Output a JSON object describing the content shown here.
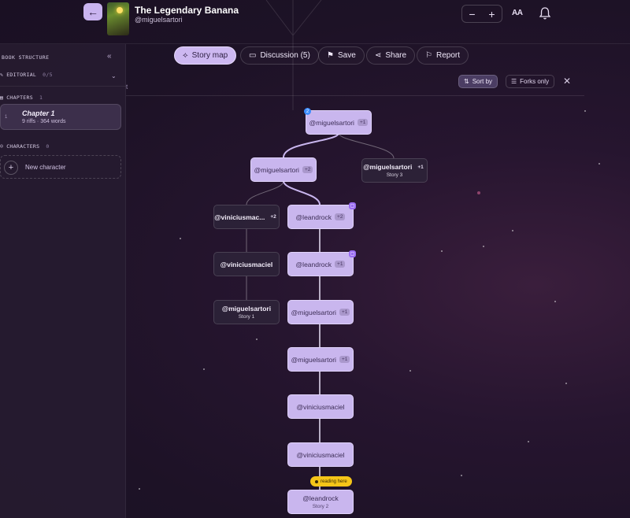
{
  "header": {
    "title": "The Legendary Banana",
    "author": "@miguelsartori",
    "zoom_out": "−",
    "zoom_in": "+",
    "font_toggle": "AA"
  },
  "sidebar": {
    "heading": "BOOK STRUCTURE",
    "editorial": {
      "label": "EDITORIAL",
      "count": "0/5"
    },
    "chapters": {
      "label": "CHAPTERS",
      "count": "1"
    },
    "chapter_items": [
      {
        "num": "1",
        "name": "Chapter 1",
        "meta": "9 riffs · 364 words"
      }
    ],
    "characters": {
      "label": "CHARACTERS",
      "count": "0"
    },
    "new_character": "New character"
  },
  "toolbar": {
    "story_map": "Story map",
    "discussion": "Discussion (5)",
    "save": "Save",
    "share": "Share",
    "report": "Report",
    "sort_by": "Sort by",
    "forks_only": "Forks only",
    "stray": "t"
  },
  "map": {
    "nodes": [
      {
        "user": "@miguelsartori",
        "badge": "+1"
      },
      {
        "user": "@miguelsartori",
        "badge": "+2"
      },
      {
        "user": "@miguelsartori",
        "badge": "+1",
        "sub": "Story 3"
      },
      {
        "user": "@viniciusmac...",
        "badge": "+2"
      },
      {
        "user": "@leandrock",
        "badge": "+2"
      },
      {
        "user": "@viniciusmaciel"
      },
      {
        "user": "@leandrock",
        "badge": "+1"
      },
      {
        "user": "@miguelsartori",
        "sub": "Story 1"
      },
      {
        "user": "@miguelsartori",
        "badge": "+1"
      },
      {
        "user": "@miguelsartori",
        "badge": "+1"
      },
      {
        "user": "@viniciusmaciel"
      },
      {
        "user": "@viniciusmaciel"
      },
      {
        "user": "@leandrock",
        "sub": "Story 2"
      }
    ],
    "root_badge": "2",
    "reading_tag": "reading here"
  },
  "colors": {
    "accent": "#c9b6ee",
    "reading": "#f5c518",
    "notice": "#3b8dff"
  }
}
